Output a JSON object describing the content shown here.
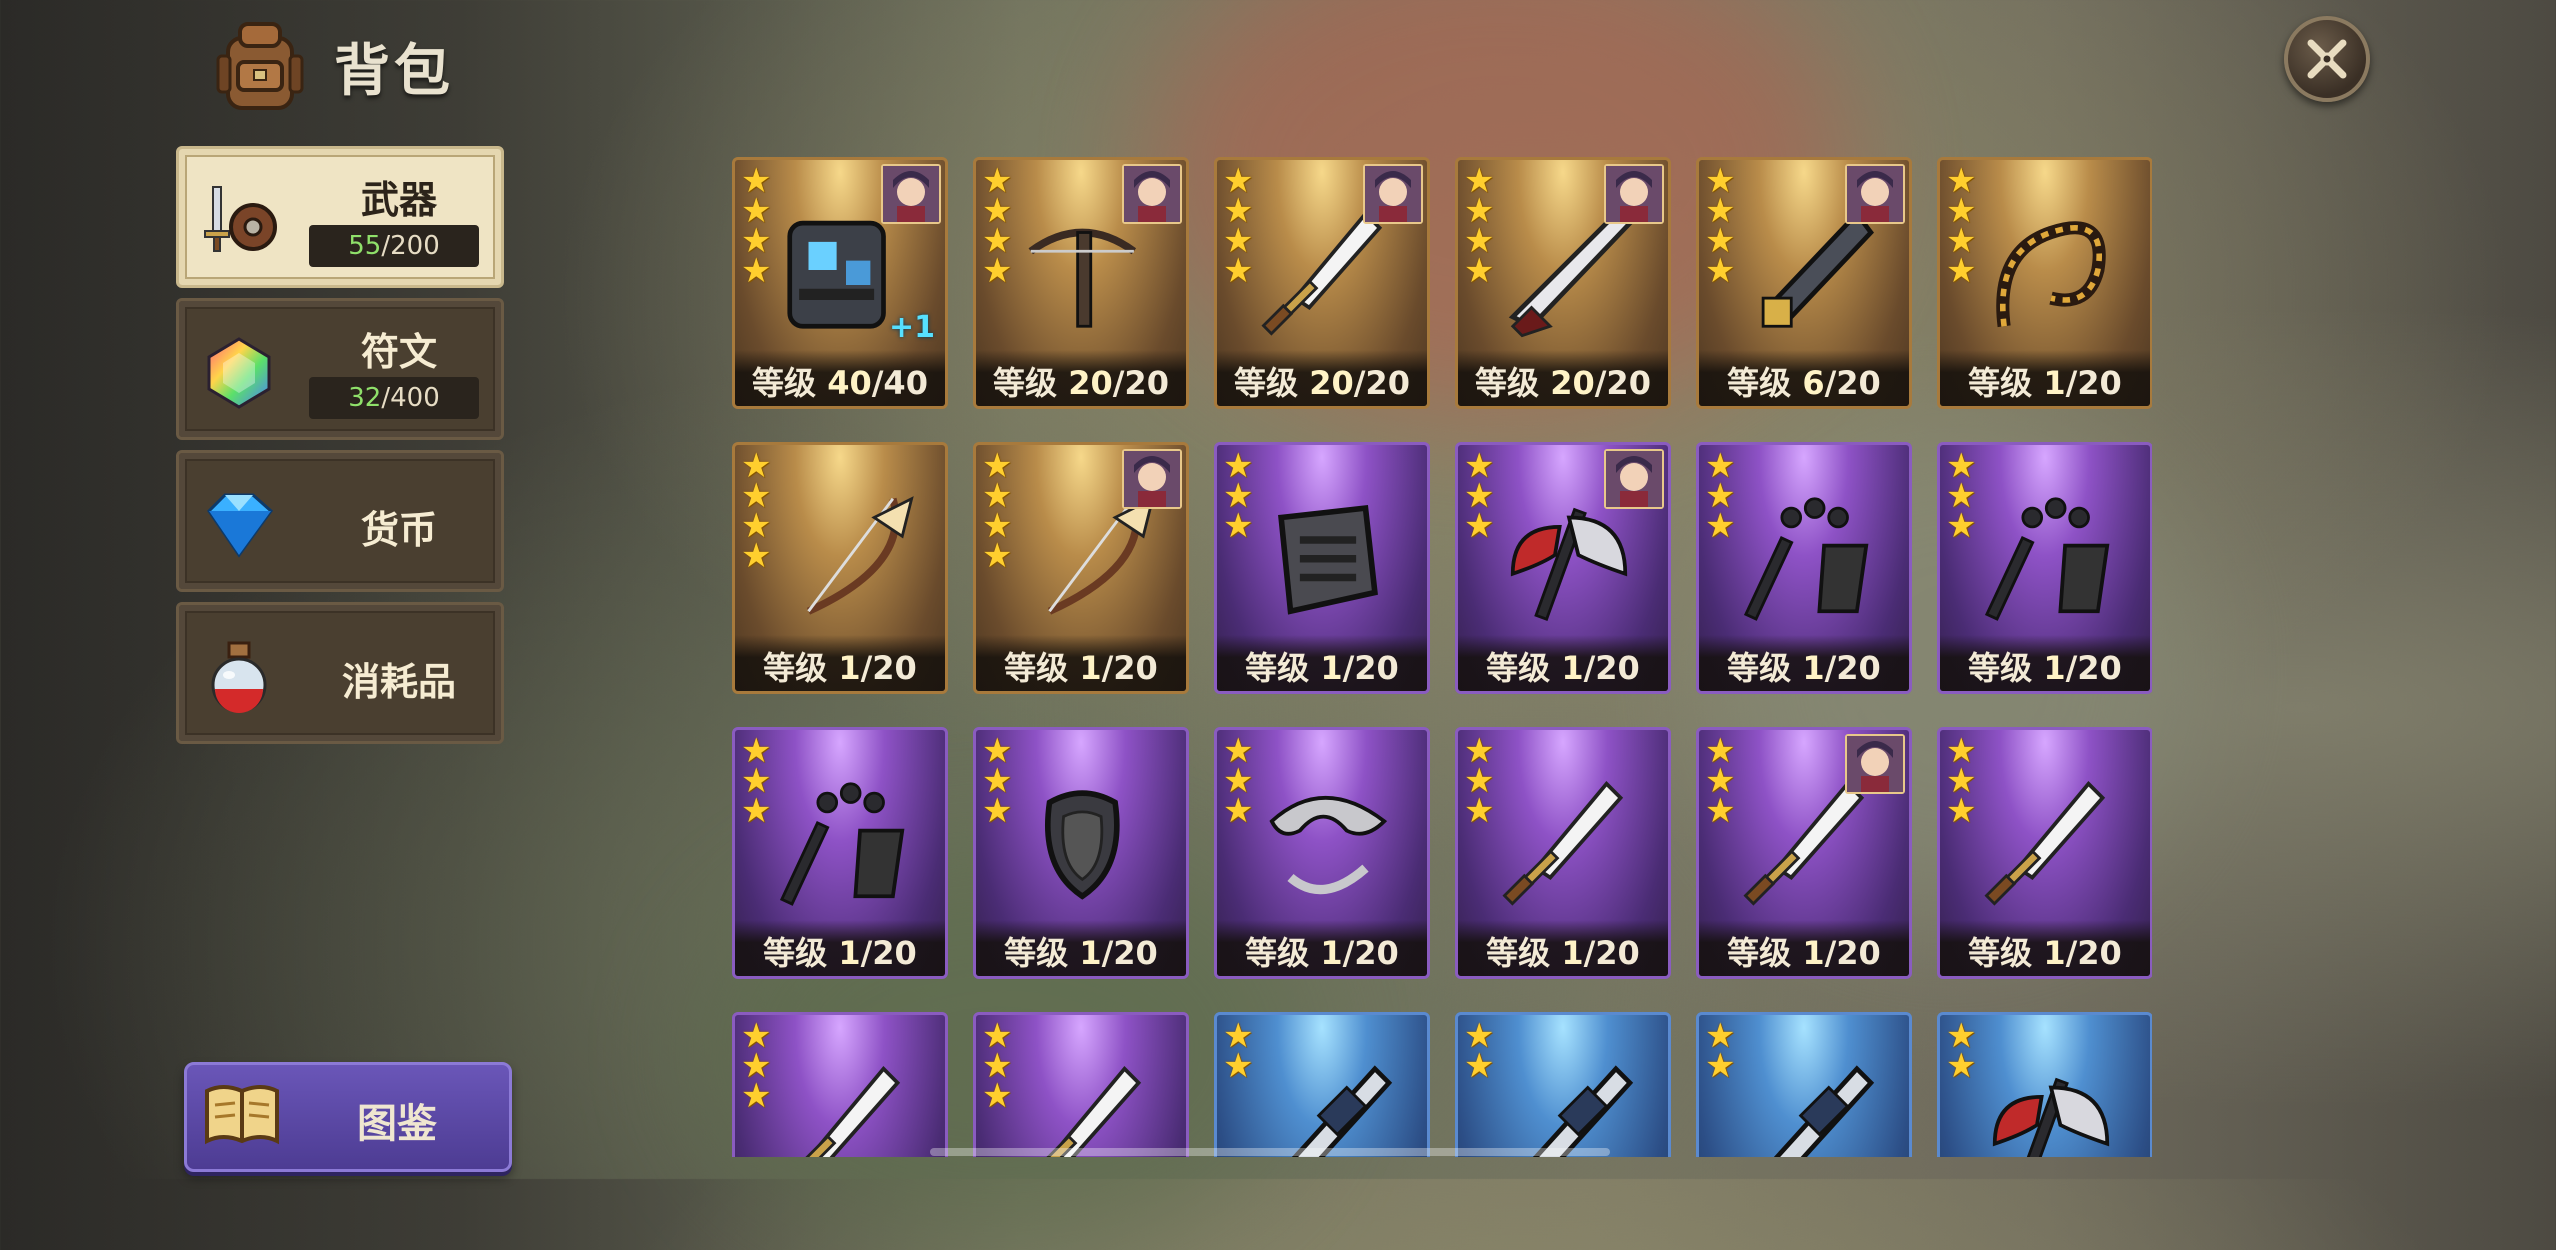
{
  "header": {
    "title": "背包",
    "icon": "backpack-icon"
  },
  "close_button": {
    "icon": "close-icon"
  },
  "sidebar": {
    "tabs": [
      {
        "id": "weapon",
        "label": "武器",
        "icon": "sword-shield-icon",
        "count_current": "55",
        "count_total": "/200",
        "active": true
      },
      {
        "id": "rune",
        "label": "符文",
        "icon": "rune-gem-icon",
        "count_current": "32",
        "count_total": "/400",
        "active": false
      },
      {
        "id": "currency",
        "label": "货币",
        "icon": "blue-gem-icon",
        "active": false
      },
      {
        "id": "consumable",
        "label": "消耗品",
        "icon": "potion-icon",
        "active": false
      }
    ]
  },
  "codex_button": {
    "label": "图鉴",
    "icon": "book-icon"
  },
  "colors": {
    "gold": "#a87a3c",
    "purple": "#8a5cc0",
    "blue": "#5a8ad0",
    "count_green": "#8fe06a",
    "star": "#ffcf2e"
  },
  "items": [
    {
      "rarity": "gold",
      "stars": 4,
      "weapon": "gauntlet-icon",
      "portrait": true,
      "plus": "+1",
      "level_prefix": "等级 ",
      "level": "40",
      "max": "/40"
    },
    {
      "rarity": "gold",
      "stars": 4,
      "weapon": "crossbow-icon",
      "portrait": true,
      "level_prefix": "等级 ",
      "level": "20",
      "max": "/20"
    },
    {
      "rarity": "gold",
      "stars": 4,
      "weapon": "sword-icon",
      "portrait": true,
      "level_prefix": "等级 ",
      "level": "20",
      "max": "/20"
    },
    {
      "rarity": "gold",
      "stars": 4,
      "weapon": "greatsword-icon",
      "portrait": true,
      "level_prefix": "等级 ",
      "level": "20",
      "max": "/20"
    },
    {
      "rarity": "gold",
      "stars": 4,
      "weapon": "cannon-icon",
      "portrait": true,
      "level_prefix": "等级 ",
      "level": "6",
      "max": "/20"
    },
    {
      "rarity": "gold",
      "stars": 4,
      "weapon": "whip-icon",
      "portrait": false,
      "level_prefix": "等级 ",
      "level": "1",
      "max": "/20"
    },
    {
      "rarity": "gold",
      "stars": 4,
      "weapon": "bow-icon",
      "portrait": false,
      "level_prefix": "等级 ",
      "level": "1",
      "max": "/20"
    },
    {
      "rarity": "gold",
      "stars": 4,
      "weapon": "bow-icon",
      "portrait": true,
      "level_prefix": "等级 ",
      "level": "1",
      "max": "/20"
    },
    {
      "rarity": "purple",
      "stars": 3,
      "weapon": "armor-icon",
      "portrait": false,
      "level_prefix": "等级 ",
      "level": "1",
      "max": "/20"
    },
    {
      "rarity": "purple",
      "stars": 3,
      "weapon": "axe-icon",
      "portrait": true,
      "level_prefix": "等级 ",
      "level": "1",
      "max": "/20"
    },
    {
      "rarity": "purple",
      "stars": 3,
      "weapon": "flail-icon",
      "portrait": false,
      "level_prefix": "等级 ",
      "level": "1",
      "max": "/20"
    },
    {
      "rarity": "purple",
      "stars": 3,
      "weapon": "flail-icon",
      "portrait": false,
      "level_prefix": "等级 ",
      "level": "1",
      "max": "/20"
    },
    {
      "rarity": "purple",
      "stars": 3,
      "weapon": "flail-icon",
      "portrait": false,
      "level_prefix": "等级 ",
      "level": "1",
      "max": "/20"
    },
    {
      "rarity": "purple",
      "stars": 3,
      "weapon": "shield-icon",
      "portrait": false,
      "level_prefix": "等级 ",
      "level": "1",
      "max": "/20"
    },
    {
      "rarity": "purple",
      "stars": 3,
      "weapon": "blade-bow-icon",
      "portrait": false,
      "level_prefix": "等级 ",
      "level": "1",
      "max": "/20"
    },
    {
      "rarity": "purple",
      "stars": 3,
      "weapon": "sword-icon",
      "portrait": false,
      "level_prefix": "等级 ",
      "level": "1",
      "max": "/20"
    },
    {
      "rarity": "purple",
      "stars": 3,
      "weapon": "sword-icon",
      "portrait": true,
      "level_prefix": "等级 ",
      "level": "1",
      "max": "/20"
    },
    {
      "rarity": "purple",
      "stars": 3,
      "weapon": "sword-icon",
      "portrait": false,
      "level_prefix": "等级 ",
      "level": "1",
      "max": "/20"
    },
    {
      "rarity": "purple",
      "stars": 3,
      "weapon": "sword-icon",
      "portrait": false
    },
    {
      "rarity": "purple",
      "stars": 3,
      "weapon": "sword-icon",
      "portrait": false
    },
    {
      "rarity": "blue",
      "stars": 2,
      "weapon": "staff-icon",
      "portrait": false
    },
    {
      "rarity": "blue",
      "stars": 2,
      "weapon": "staff-icon",
      "portrait": false
    },
    {
      "rarity": "blue",
      "stars": 2,
      "weapon": "staff-icon",
      "portrait": false
    },
    {
      "rarity": "blue",
      "stars": 2,
      "weapon": "axe-icon",
      "portrait": false
    }
  ]
}
